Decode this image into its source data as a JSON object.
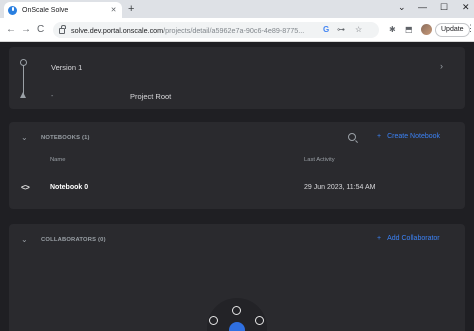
{
  "browser": {
    "tab_title": "OnScale Solve",
    "tab_close": "✕",
    "new_tab": "+",
    "window_controls": [
      "⌄",
      "—",
      "☐",
      "✕"
    ],
    "nav": {
      "back": "←",
      "forward": "→",
      "reload": "C"
    },
    "url_host": "solve.dev.portal.onscale.com",
    "url_path": "/projects/detail/a5962e7a-90c6-4e89-8775...",
    "toolbar_icons": [
      "G",
      "⊶",
      "☆",
      "✱",
      "⬒"
    ],
    "update_label": "Update",
    "menu": "⋮"
  },
  "version": {
    "label": "Version 1",
    "chevron": "›",
    "dash": "-",
    "root_label": "Project Root"
  },
  "notebooks": {
    "chevron": "⌄",
    "title": "NOTEBOOKS (1)",
    "create_label": "Create Notebook",
    "plus": "+",
    "col_name": "Name",
    "col_activity": "Last Activity",
    "rows": [
      {
        "icon": "<>",
        "name": "Notebook 0",
        "last_activity": "29 Jun 2023, 11:54 AM"
      }
    ]
  },
  "collaborators": {
    "chevron": "⌄",
    "title": "COLLABORATORS (0)",
    "add_label": "Add Collaborator",
    "plus": "+"
  },
  "colors": {
    "accent": "#3b82f6",
    "page_bg": "#1f1f23",
    "card_bg": "#2a2a2e"
  }
}
